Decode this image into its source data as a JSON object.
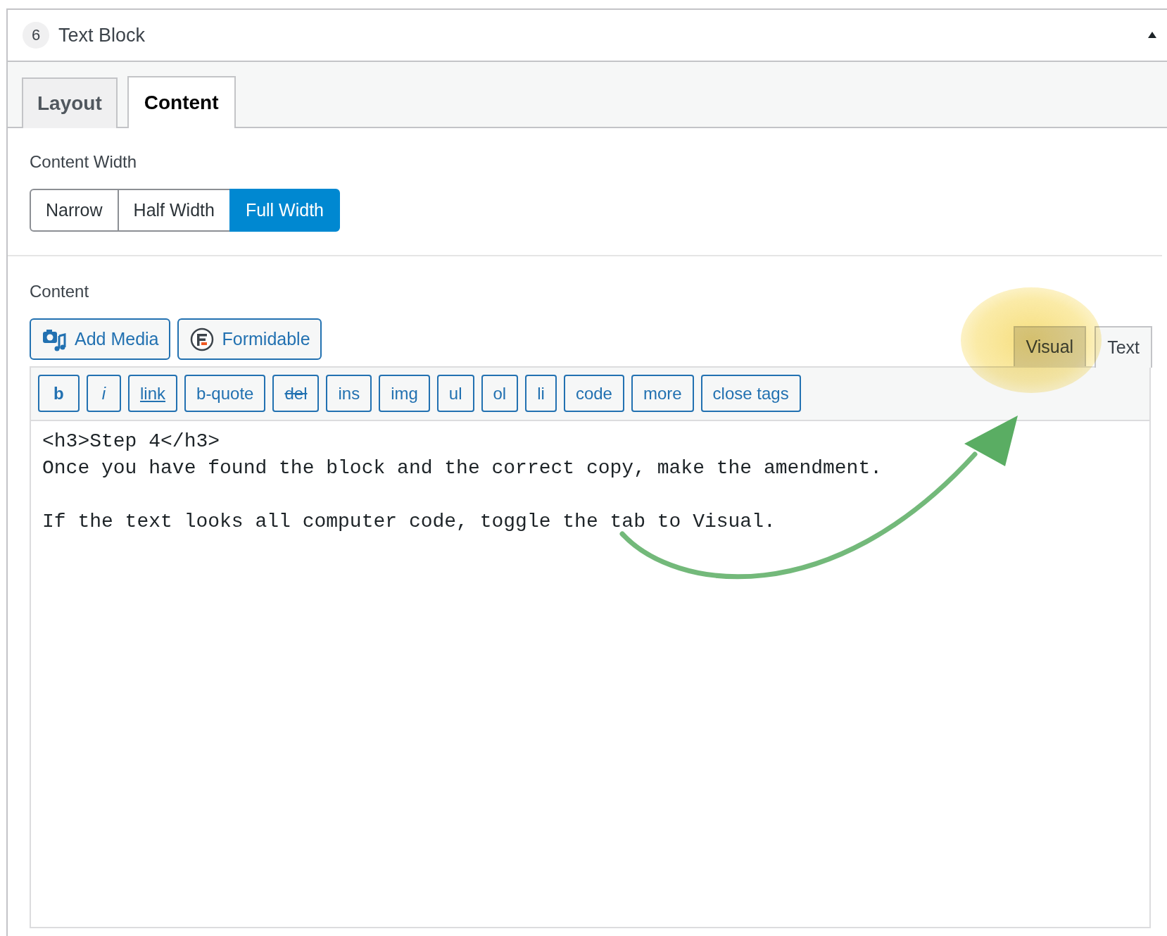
{
  "panel": {
    "number": "6",
    "title": "Text Block",
    "expanded": true
  },
  "tabs": [
    {
      "label": "Layout",
      "selected": false
    },
    {
      "label": "Content",
      "selected": true
    }
  ],
  "content_width": {
    "label": "Content Width",
    "options": [
      {
        "label": "Narrow",
        "selected": false
      },
      {
        "label": "Half Width",
        "selected": false
      },
      {
        "label": "Full Width",
        "selected": true
      }
    ]
  },
  "content": {
    "label": "Content",
    "media_buttons": [
      {
        "label": "Add Media",
        "kind": "media"
      },
      {
        "label": "Formidable",
        "kind": "formidable"
      }
    ],
    "editor_tabs": [
      {
        "label": "Visual",
        "selected": false
      },
      {
        "label": "Text",
        "selected": true
      }
    ],
    "quicktags": [
      {
        "label": "b",
        "kind": "bold"
      },
      {
        "label": "i",
        "kind": "italic"
      },
      {
        "label": "link",
        "kind": "link"
      },
      {
        "label": "b-quote",
        "kind": "plain"
      },
      {
        "label": "del",
        "kind": "strike"
      },
      {
        "label": "ins",
        "kind": "plain"
      },
      {
        "label": "img",
        "kind": "plain"
      },
      {
        "label": "ul",
        "kind": "plain"
      },
      {
        "label": "ol",
        "kind": "plain"
      },
      {
        "label": "li",
        "kind": "plain"
      },
      {
        "label": "code",
        "kind": "plain"
      },
      {
        "label": "more",
        "kind": "plain"
      },
      {
        "label": "close tags",
        "kind": "plain"
      }
    ],
    "text": "<h3>Step 4</h3>\nOnce you have found the block and the correct copy, make the amendment.\n\nIf the text looks all computer code, toggle the tab to Visual."
  }
}
